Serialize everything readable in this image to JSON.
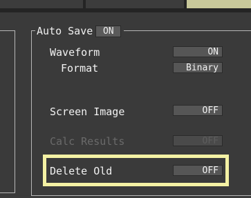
{
  "auto_save": {
    "label": "Auto Save",
    "value": "ON"
  },
  "waveform": {
    "label": "Waveform",
    "value": "ON"
  },
  "format": {
    "label": "Format",
    "value": "Binary"
  },
  "screen_image": {
    "label": "Screen Image",
    "value": "OFF"
  },
  "calc_results": {
    "label": "Calc Results",
    "value": "OFF",
    "disabled": true
  },
  "delete_old": {
    "label": "Delete Old",
    "value": "OFF",
    "highlighted": true
  },
  "colors": {
    "background": "#3a3a3a",
    "field": "#565656",
    "highlight": "#f4f1a4",
    "text": "#f2f2f2",
    "disabled_text": "#6a6a6a"
  }
}
